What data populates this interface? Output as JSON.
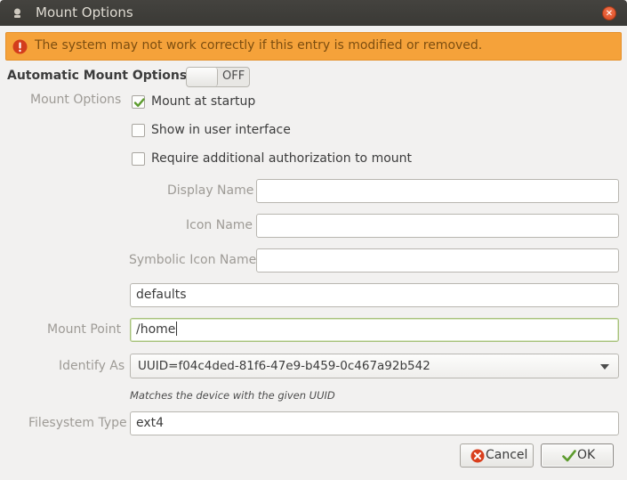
{
  "window": {
    "title": "Mount Options"
  },
  "warning": {
    "text": "The system may not work correctly if this entry is modified or removed."
  },
  "automatic": {
    "label": "Automatic Mount Options",
    "switch_state": "OFF"
  },
  "mount_options": {
    "label": "Mount Options",
    "checkboxes": [
      {
        "label": "Mount at startup",
        "checked": true
      },
      {
        "label": "Show in user interface",
        "checked": false
      },
      {
        "label": "Require additional authorization to mount",
        "checked": false
      }
    ]
  },
  "fields": {
    "display_name": {
      "label": "Display Name",
      "value": ""
    },
    "icon_name": {
      "label": "Icon Name",
      "value": ""
    },
    "symbolic_icon_name": {
      "label": "Symbolic Icon Name",
      "value": ""
    },
    "options": {
      "value": "defaults"
    },
    "mount_point": {
      "label": "Mount Point",
      "value": "/home"
    },
    "identify_as": {
      "label": "Identify As",
      "value": "UUID=f04c4ded-81f6-47e9-b459-0c467a92b542",
      "hint": "Matches the device with the given UUID"
    },
    "filesystem_type": {
      "label": "Filesystem Type",
      "value": "ext4"
    }
  },
  "buttons": {
    "cancel": "Cancel",
    "ok": "OK"
  },
  "icons": {
    "warning": "warning-icon",
    "close": "close-icon",
    "cancel": "cancel-icon",
    "ok": "checkmark-icon"
  },
  "colors": {
    "warning_bg": "#f5a23a",
    "title_bg": "#3c3b37",
    "close": "#e0552b",
    "check": "#5c9b2d"
  }
}
